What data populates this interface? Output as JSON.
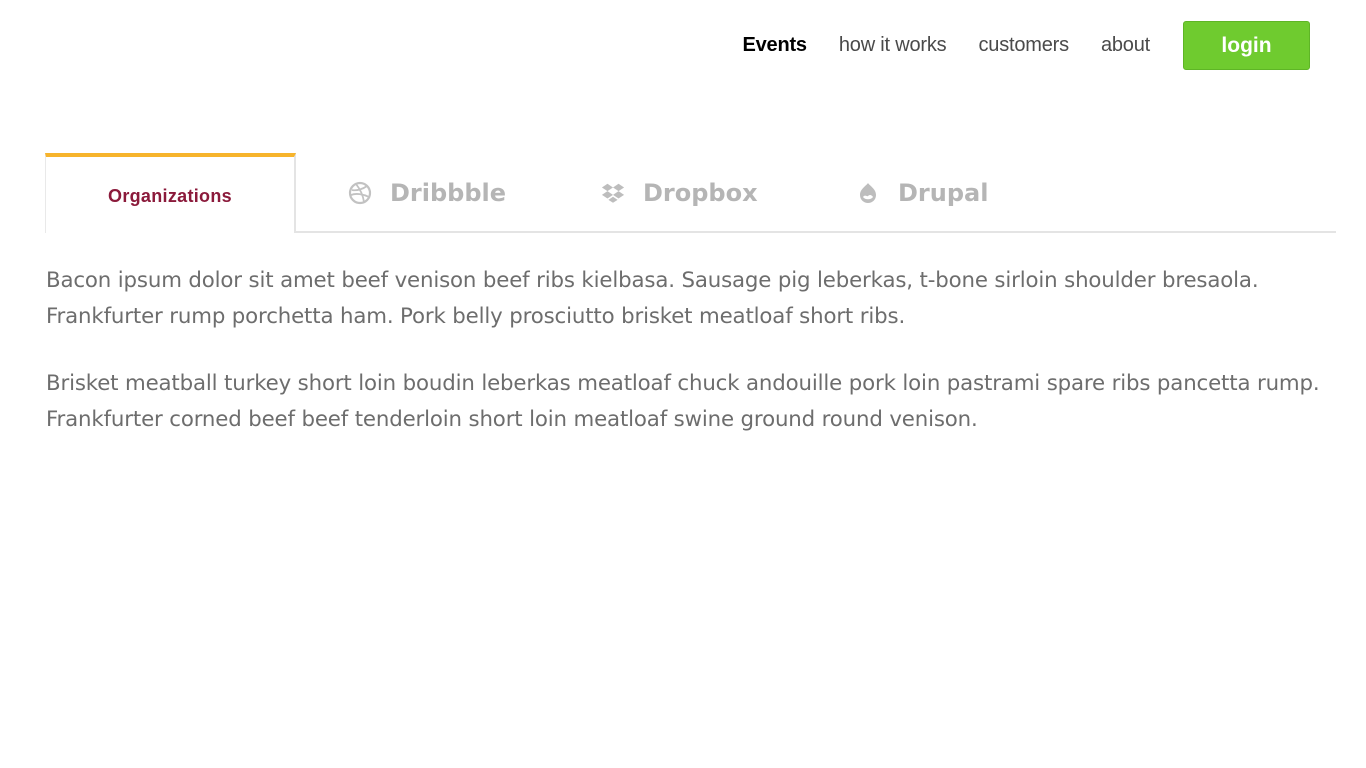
{
  "nav": {
    "items": [
      {
        "label": "Events",
        "active": true
      },
      {
        "label": "how it works",
        "active": false
      },
      {
        "label": "customers",
        "active": false
      },
      {
        "label": "about",
        "active": false
      }
    ],
    "login_label": "login"
  },
  "tabs": [
    {
      "label": "Organizations",
      "icon": "",
      "active": true
    },
    {
      "label": "Dribbble",
      "icon": "dribbble-icon",
      "active": false
    },
    {
      "label": "Dropbox",
      "icon": "dropbox-icon",
      "active": false
    },
    {
      "label": "Drupal",
      "icon": "drupal-icon",
      "active": false
    }
  ],
  "content": {
    "paragraphs": [
      "Bacon ipsum dolor sit amet beef venison beef ribs kielbasa. Sausage pig leberkas, t-bone sirloin shoulder bresaola. Frankfurter rump porchetta ham. Pork belly prosciutto brisket meatloaf short ribs.",
      "Brisket meatball turkey short loin boudin leberkas meatloaf chuck andouille pork loin pastrami spare ribs pancetta rump. Frankfurter corned beef beef tenderloin short loin meatloaf swine ground round venison."
    ]
  },
  "colors": {
    "login_green": "#6fcb2f",
    "active_tab_border": "#f7b42c",
    "active_tab_text": "#8b1a3b",
    "inactive_tab_text": "#b5b5b5",
    "body_text": "#6d6d6d"
  }
}
